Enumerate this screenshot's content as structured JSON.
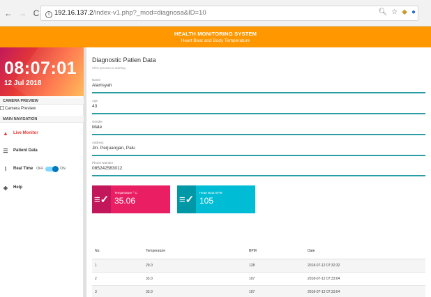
{
  "browser": {
    "url_host": "192.16.137.2",
    "url_path": "/index-v1.php?_mod=diagnosa&ID=10"
  },
  "header": {
    "title": "HEALTH MONITORING SYSTEM",
    "subtitle": "Heart Beat and Body Temperature"
  },
  "sidebar": {
    "time": "08:07:01",
    "date": "12 Jul 2018",
    "camera_section": "CAMERA PREVIEW",
    "camera_alt": "Camera Preview",
    "nav_section": "MAIN NAVIGATION",
    "items": [
      {
        "label": "Live Monitor",
        "icon": "home-icon"
      },
      {
        "label": "Patient Data",
        "icon": "list-icon"
      },
      {
        "label": "Real Time",
        "icon": "sensor-icon"
      },
      {
        "label": "Help",
        "icon": "layers-icon"
      }
    ],
    "switch_off": "OFF",
    "switch_on": "ON"
  },
  "main": {
    "title": "Diagnostic Patien Data",
    "subtitle": "Click process to starting.",
    "fields": [
      {
        "label": "Name",
        "value": "Alamsyah"
      },
      {
        "label": "Age",
        "value": "43"
      },
      {
        "label": "Gender",
        "value": "Male"
      },
      {
        "label": "Address",
        "value": "Jln. Perjuangan, Palu"
      },
      {
        "label": "Phone Number",
        "value": "085242583012"
      }
    ],
    "temperature": {
      "label": "Temperature ° C",
      "value": "35.06"
    },
    "heartbeat": {
      "label": "Heart Beat BPM",
      "value": "105"
    },
    "table": {
      "headers": [
        "No.",
        "Temperature",
        "BPM",
        "Date"
      ],
      "rows": [
        [
          "1",
          "29.0",
          "128",
          "2018-07-12 07:32:32"
        ],
        [
          "2",
          "33.0",
          "107",
          "2018-07-12 07:33:04"
        ],
        [
          "3",
          "33.0",
          "107",
          "2018-07-12 07:33:04"
        ]
      ]
    }
  },
  "colors": {
    "header": "#ff9800",
    "temperature": "#e91e63",
    "heartbeat": "#00bcd4",
    "active_nav": "#e53935",
    "field_underline": "#2a9da4"
  }
}
